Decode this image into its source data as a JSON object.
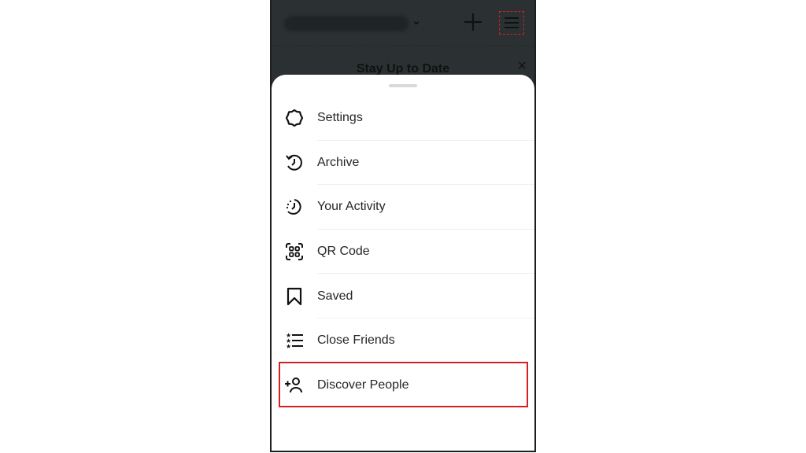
{
  "topbar": {
    "username": "username_blurred",
    "plus_icon": "plus-icon",
    "menu_icon": "hamburger-menu-icon"
  },
  "banner": {
    "title": "Stay Up to Date",
    "close_icon": "×"
  },
  "menu": {
    "items": [
      {
        "label": "Settings",
        "icon": "settings-icon"
      },
      {
        "label": "Archive",
        "icon": "archive-icon"
      },
      {
        "label": "Your Activity",
        "icon": "activity-icon"
      },
      {
        "label": "QR Code",
        "icon": "qr-code-icon"
      },
      {
        "label": "Saved",
        "icon": "bookmark-icon"
      },
      {
        "label": "Close Friends",
        "icon": "close-friends-icon"
      },
      {
        "label": "Discover People",
        "icon": "add-person-icon"
      }
    ]
  },
  "annotation": {
    "highlight_color": "#d32121",
    "highlighted_item": "Discover People"
  }
}
